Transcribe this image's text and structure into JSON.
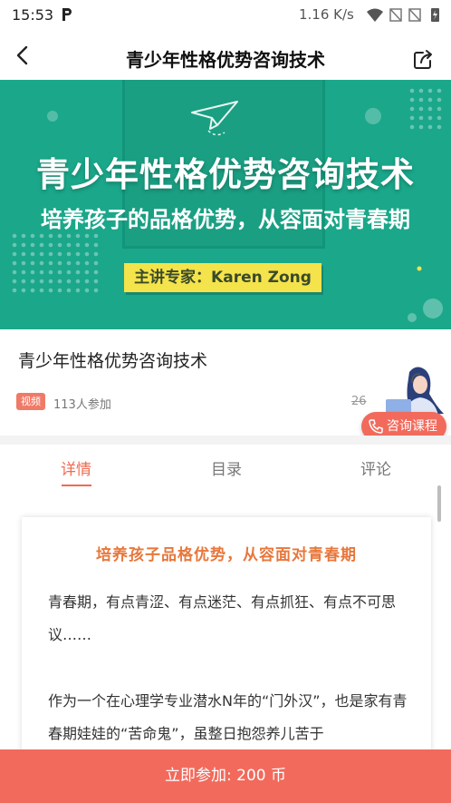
{
  "status_bar": {
    "time": "15:53",
    "network_speed": "1.16 K/s"
  },
  "nav": {
    "title": "青少年性格优势咨询技术"
  },
  "banner": {
    "title": "青少年性格优势咨询技术",
    "subtitle": "培养孩子的品格优势，从容面对青春期",
    "expert": "主讲专家：Karen  Zong"
  },
  "course": {
    "title": "青少年性格优势咨询技术",
    "badge": "视频",
    "participants": "113人参加",
    "old_price": "26"
  },
  "consult": {
    "label": "咨询课程"
  },
  "tabs": [
    {
      "label": "详情"
    },
    {
      "label": "目录"
    },
    {
      "label": "评论"
    }
  ],
  "content": {
    "heading": "培养孩子品格优势，从容面对青春期",
    "para1": "青春期，有点青涩、有点迷茫、有点抓狂、有点不可思议……",
    "para2": "作为一个在心理学专业潜水N年的“门外汉”，也是家有青春期娃娃的“苦命鬼”，虽整日抱怨养儿苦于"
  },
  "cta": {
    "label": "立即参加: 200 币"
  },
  "colors": {
    "accent": "#f26a5c",
    "banner_green": "#1ba78a",
    "tab_active": "#f06a50",
    "heading_orange": "#e8773b"
  }
}
